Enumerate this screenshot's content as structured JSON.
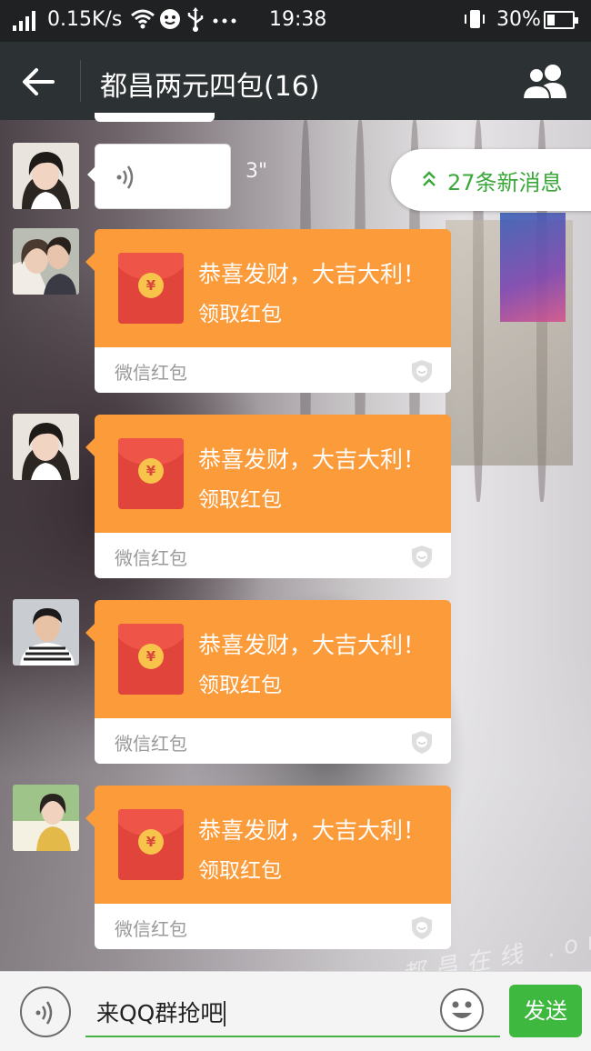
{
  "status_bar": {
    "net_speed": "0.15K/s",
    "time": "19:38",
    "battery_percent": "30%",
    "battery_level": 0.3,
    "icons": [
      "signal-icon",
      "wifi-icon",
      "app-notification-icon",
      "usb-icon",
      "more-dots-icon",
      "phone-vibrate-icon",
      "battery-icon"
    ]
  },
  "header": {
    "title": "都昌两元四包(16)",
    "back_icon": "arrow-left-icon",
    "members_icon": "group-members-icon"
  },
  "new_messages": {
    "label": "27条新消息",
    "icon": "double-chevron-up-icon"
  },
  "voice_message": {
    "duration": "3\"",
    "icon": "voice-waves-icon"
  },
  "messages": [
    {
      "type": "red_packet",
      "greeting": "恭喜发财，大吉大利！",
      "action": "领取红包",
      "brand": "微信红包"
    },
    {
      "type": "red_packet",
      "greeting": "恭喜发财，大吉大利！",
      "action": "领取红包",
      "brand": "微信红包"
    },
    {
      "type": "red_packet",
      "greeting": "恭喜发财，大吉大利！",
      "action": "领取红包",
      "brand": "微信红包"
    },
    {
      "type": "red_packet",
      "greeting": "恭喜发财，大吉大利！",
      "action": "领取红包",
      "brand": "微信红包"
    }
  ],
  "red_packet": {
    "coin_symbol": "¥"
  },
  "input_bar": {
    "value": "来QQ群抢吧",
    "send_label": "发送"
  },
  "watermark": "都昌在线 .org",
  "colors": {
    "title_bar": "#2c3133",
    "red_packet_orange": "#fb9b3a",
    "send_green": "#3fb83f",
    "accent_green": "#3aa83a"
  }
}
